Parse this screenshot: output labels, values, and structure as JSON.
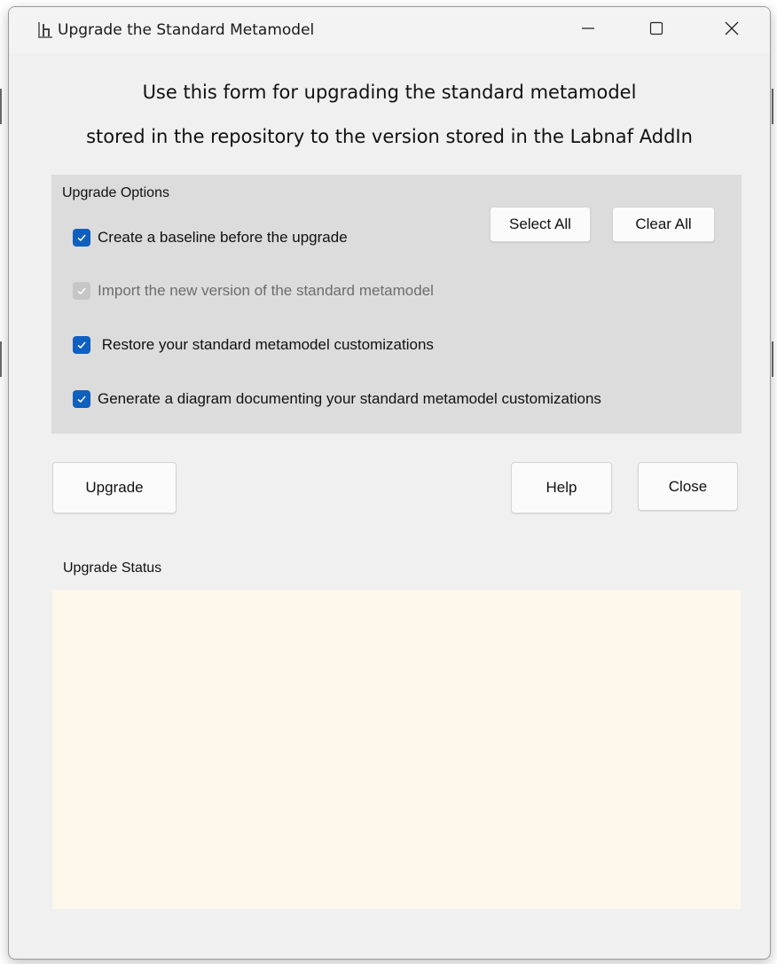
{
  "window": {
    "title": "Upgrade the Standard Metamodel",
    "icon": "labnaf-app-icon",
    "controls": {
      "minimize_icon": "minimize-icon",
      "maximize_icon": "maximize-icon",
      "close_icon": "close-icon"
    }
  },
  "heading": {
    "line1": "Use this form for upgrading the standard metamodel",
    "line2": "stored in the repository to the version stored in the Labnaf AddIn"
  },
  "options": {
    "group_label": "Upgrade Options",
    "select_all_label": "Select All",
    "clear_all_label": "Clear All",
    "items": [
      {
        "label": "Create a baseline before the upgrade",
        "checked": true,
        "enabled": true
      },
      {
        "label": "Import the new version of the standard metamodel",
        "checked": true,
        "enabled": false
      },
      {
        "label": " Restore your standard metamodel customizations",
        "checked": true,
        "enabled": true
      },
      {
        "label": "Generate a diagram documenting your standard metamodel customizations",
        "checked": true,
        "enabled": true
      }
    ]
  },
  "actions": {
    "upgrade_label": "Upgrade",
    "help_label": "Help",
    "close_label": "Close"
  },
  "status": {
    "label": "Upgrade Status",
    "value": ""
  },
  "colors": {
    "checkbox_checked": "#0f5fbf",
    "checkbox_disabled": "#c6c6c6",
    "options_panel_bg": "#dcdcdc",
    "status_bg": "#fdf7ec",
    "window_bg": "#f0f0f0"
  }
}
